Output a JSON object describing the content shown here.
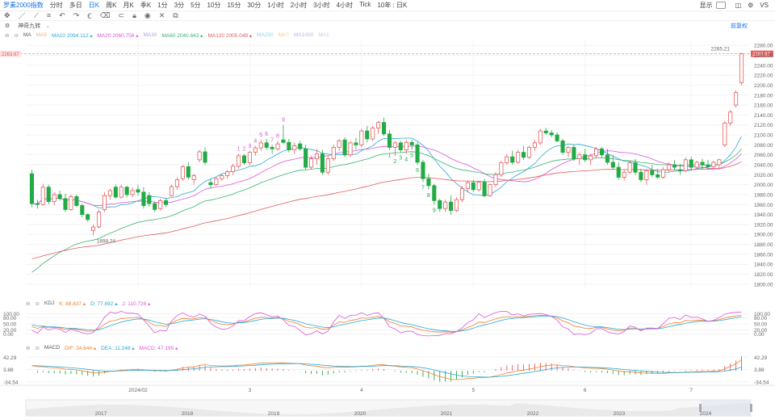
{
  "toolbar": {
    "title": "罗素2000指数",
    "periods": [
      "分时",
      "多日",
      "日K",
      "周K",
      "月K",
      "季K",
      "1分",
      "3分",
      "5分",
      "10分",
      "15分",
      "30分",
      "1小时",
      "2小时",
      "3小时",
      "4小时",
      "Tick"
    ],
    "active_period": "日K",
    "range_select": "10年 : 日K",
    "display_label": "显示",
    "vs_label": "VS"
  },
  "indicator_row": {
    "name": "神奇九转",
    "button": "前复权"
  },
  "ma_legend": [
    {
      "label": "MA",
      "value": "",
      "color": "#555555"
    },
    {
      "label": "MA5",
      "value": "",
      "color": "#f4b183"
    },
    {
      "label": "MA10",
      "value": "2094.112",
      "color": "#29a9d6"
    },
    {
      "label": "MA20",
      "value": "2060.758",
      "color": "#d957d9"
    },
    {
      "label": "MA30",
      "value": "",
      "color": "#a6a6e0"
    },
    {
      "label": "MA60",
      "value": "2040.643",
      "color": "#3cb371"
    },
    {
      "label": "MA120",
      "value": "2005.049",
      "color": "#e45c5c"
    },
    {
      "label": "MA250",
      "value": "",
      "color": "#8fd9e8"
    },
    {
      "label": "MA?",
      "value": "",
      "color": "#f0d080"
    },
    {
      "label": "MA1000",
      "value": "",
      "color": "#c0b0f0"
    },
    {
      "label": "MA1",
      "value": "",
      "color": "#c8c8e8"
    }
  ],
  "kdj_legend": [
    {
      "label": "KDJ",
      "value": "",
      "color": "#555555"
    },
    {
      "label": "K:",
      "value": "88.837",
      "color": "#f08030"
    },
    {
      "label": "D:",
      "value": "77.892",
      "color": "#29a9d6"
    },
    {
      "label": "J:",
      "value": "110.726",
      "color": "#d957d9"
    }
  ],
  "macd_legend": [
    {
      "label": "MACD",
      "value": "",
      "color": "#555555"
    },
    {
      "label": "DIF:",
      "value": "34.644",
      "color": "#f08030"
    },
    {
      "label": "DEA:",
      "value": "11.246",
      "color": "#29a9d6"
    },
    {
      "label": "MACD:",
      "value": "47.195",
      "color": "#d957d9"
    }
  ],
  "chart_data": {
    "type": "candlestick",
    "y_ticks": [
      2280,
      2260,
      2240,
      2220,
      2200,
      2180,
      2160,
      2140,
      2120,
      2100,
      2080,
      2060,
      2040,
      2020,
      2000,
      1980,
      1960,
      1940,
      1920,
      1900,
      1880,
      1860,
      1840,
      1820,
      1800
    ],
    "ylim": [
      1790,
      2290
    ],
    "last_price_label": "2263.67",
    "annotations": {
      "high": "2265.21",
      "low": "1898.24"
    },
    "x_labels": [
      {
        "label": "2024/02",
        "i": 19
      },
      {
        "label": "3",
        "i": 39
      },
      {
        "label": "4",
        "i": 59
      },
      {
        "label": "5",
        "i": 79
      },
      {
        "label": "6",
        "i": 99
      },
      {
        "label": "7",
        "i": 118
      }
    ],
    "nine_turn": [
      {
        "i": 37,
        "n": "1",
        "side": "top"
      },
      {
        "i": 38,
        "n": "2",
        "side": "top"
      },
      {
        "i": 39,
        "n": "3",
        "side": "top"
      },
      {
        "i": 40,
        "n": "4",
        "side": "top"
      },
      {
        "i": 41,
        "n": "5",
        "side": "top"
      },
      {
        "i": 42,
        "n": "6",
        "side": "top"
      },
      {
        "i": 43,
        "n": "7",
        "side": "top"
      },
      {
        "i": 44,
        "n": "8",
        "side": "top"
      },
      {
        "i": 45,
        "n": "9",
        "side": "top"
      },
      {
        "i": 64,
        "n": "1",
        "side": "bottom"
      },
      {
        "i": 65,
        "n": "2",
        "side": "bottom"
      },
      {
        "i": 66,
        "n": "3",
        "side": "bottom"
      },
      {
        "i": 67,
        "n": "4",
        "side": "bottom"
      },
      {
        "i": 68,
        "n": "5",
        "side": "bottom"
      },
      {
        "i": 69,
        "n": "6",
        "side": "bottom"
      },
      {
        "i": 70,
        "n": "7",
        "side": "bottom"
      },
      {
        "i": 71,
        "n": "8",
        "side": "bottom"
      },
      {
        "i": 72,
        "n": "9",
        "side": "bottom"
      }
    ],
    "candles": [
      [
        2022,
        2030,
        1955,
        1962
      ],
      [
        1962,
        1970,
        1952,
        1960
      ],
      [
        1960,
        2002,
        1958,
        1995
      ],
      [
        1995,
        2000,
        1960,
        1966
      ],
      [
        1966,
        1985,
        1958,
        1980
      ],
      [
        1980,
        1988,
        1968,
        1972
      ],
      [
        1972,
        1982,
        1945,
        1950
      ],
      [
        1950,
        1980,
        1948,
        1976
      ],
      [
        1976,
        1980,
        1955,
        1958
      ],
      [
        1958,
        1962,
        1935,
        1940
      ],
      [
        1940,
        1942,
        1926,
        1930
      ],
      [
        1908,
        1920,
        1898,
        1915
      ],
      [
        1915,
        1950,
        1912,
        1945
      ],
      [
        1950,
        1985,
        1945,
        1978
      ],
      [
        1978,
        1992,
        1970,
        1988
      ],
      [
        1995,
        2000,
        1972,
        1975
      ],
      [
        1975,
        2000,
        1972,
        1995
      ],
      [
        1995,
        1998,
        1975,
        1980
      ],
      [
        1980,
        1995,
        1975,
        1988
      ],
      [
        1990,
        2000,
        1978,
        1985
      ],
      [
        1985,
        1995,
        1952,
        1958
      ],
      [
        1978,
        1985,
        1955,
        1962
      ],
      [
        1962,
        1966,
        1945,
        1950
      ],
      [
        1952,
        1972,
        1948,
        1968
      ],
      [
        1968,
        1972,
        1955,
        1960
      ],
      [
        1978,
        2000,
        1976,
        1996
      ],
      [
        1996,
        2015,
        1990,
        2010
      ],
      [
        2012,
        2040,
        2008,
        2036
      ],
      [
        2036,
        2045,
        2010,
        2015
      ],
      [
        2010,
        2022,
        2000,
        2018
      ],
      [
        2050,
        2070,
        2045,
        2066
      ],
      [
        2066,
        2075,
        2040,
        2045
      ],
      [
        2004,
        2012,
        1992,
        2000
      ],
      [
        2000,
        2015,
        1998,
        2012
      ],
      [
        2012,
        2022,
        2008,
        2018
      ],
      [
        2018,
        2030,
        2012,
        2026
      ],
      [
        2026,
        2042,
        2020,
        2037
      ],
      [
        2037,
        2062,
        2032,
        2058
      ],
      [
        2058,
        2062,
        2040,
        2044
      ],
      [
        2044,
        2068,
        2040,
        2065
      ],
      [
        2065,
        2078,
        2058,
        2074
      ],
      [
        2074,
        2090,
        2068,
        2084
      ],
      [
        2084,
        2092,
        2070,
        2075
      ],
      [
        2075,
        2080,
        2062,
        2072
      ],
      [
        2072,
        2088,
        2068,
        2082
      ],
      [
        2090,
        2120,
        2082,
        2085
      ],
      [
        2085,
        2092,
        2065,
        2070
      ],
      [
        2070,
        2085,
        2062,
        2078
      ],
      [
        2082,
        2088,
        2068,
        2072
      ],
      [
        2072,
        2080,
        2030,
        2035
      ],
      [
        2035,
        2058,
        2030,
        2052
      ],
      [
        2052,
        2072,
        2040,
        2062
      ],
      [
        2062,
        2070,
        2020,
        2025
      ],
      [
        2025,
        2058,
        2020,
        2052
      ],
      [
        2052,
        2080,
        2048,
        2075
      ],
      [
        2075,
        2092,
        2068,
        2088
      ],
      [
        2090,
        2095,
        2055,
        2060
      ],
      [
        2060,
        2088,
        2055,
        2084
      ],
      [
        2084,
        2094,
        2070,
        2080
      ],
      [
        2080,
        2112,
        2075,
        2108
      ],
      [
        2108,
        2118,
        2085,
        2092
      ],
      [
        2092,
        2118,
        2088,
        2114
      ],
      [
        2114,
        2128,
        2102,
        2125
      ],
      [
        2125,
        2135,
        2098,
        2102
      ],
      [
        2102,
        2110,
        2070,
        2075
      ],
      [
        2075,
        2088,
        2058,
        2084
      ],
      [
        2084,
        2088,
        2065,
        2070
      ],
      [
        2070,
        2090,
        2062,
        2085
      ],
      [
        2085,
        2090,
        2070,
        2080
      ],
      [
        2080,
        2085,
        2040,
        2045
      ],
      [
        2045,
        2050,
        2005,
        2012
      ],
      [
        2012,
        2022,
        1990,
        1998
      ],
      [
        1998,
        2002,
        1960,
        1968
      ],
      [
        1968,
        1972,
        1945,
        1952
      ],
      [
        1952,
        1970,
        1945,
        1965
      ],
      [
        1965,
        1978,
        1940,
        1948
      ],
      [
        1948,
        1975,
        1945,
        1970
      ],
      [
        1970,
        1998,
        1965,
        1992
      ],
      [
        1992,
        2008,
        1985,
        2004
      ],
      [
        2004,
        2010,
        1985,
        1990
      ],
      [
        1990,
        2008,
        1986,
        2005
      ],
      [
        2005,
        2012,
        1975,
        1978
      ],
      [
        1978,
        2002,
        1975,
        2000
      ],
      [
        2000,
        2025,
        1995,
        2020
      ],
      [
        2020,
        2048,
        2015,
        2044
      ],
      [
        2044,
        2062,
        2040,
        2056
      ],
      [
        2056,
        2068,
        2040,
        2045
      ],
      [
        2045,
        2070,
        2042,
        2065
      ],
      [
        2065,
        2078,
        2050,
        2055
      ],
      [
        2055,
        2078,
        2052,
        2075
      ],
      [
        2075,
        2090,
        2068,
        2084
      ],
      [
        2084,
        2112,
        2080,
        2108
      ],
      [
        2108,
        2114,
        2100,
        2104
      ],
      [
        2104,
        2110,
        2095,
        2100
      ],
      [
        2100,
        2105,
        2085,
        2088
      ],
      [
        2088,
        2092,
        2060,
        2065
      ],
      [
        2065,
        2078,
        2055,
        2075
      ],
      [
        2075,
        2080,
        2048,
        2052
      ],
      [
        2052,
        2064,
        2040,
        2060
      ],
      [
        2060,
        2072,
        2045,
        2050
      ],
      [
        2050,
        2062,
        2040,
        2058
      ],
      [
        2058,
        2076,
        2054,
        2072
      ],
      [
        2072,
        2076,
        2055,
        2060
      ],
      [
        2060,
        2072,
        2040,
        2045
      ],
      [
        2045,
        2060,
        2030,
        2035
      ],
      [
        2035,
        2045,
        2010,
        2015
      ],
      [
        2015,
        2030,
        2008,
        2025
      ],
      [
        2025,
        2048,
        2022,
        2044
      ],
      [
        2044,
        2052,
        2020,
        2025
      ],
      [
        2025,
        2032,
        2005,
        2010
      ],
      [
        2010,
        2030,
        2000,
        2028
      ],
      [
        2028,
        2040,
        2015,
        2020
      ],
      [
        2020,
        2032,
        2012,
        2015
      ],
      [
        2015,
        2035,
        2012,
        2030
      ],
      [
        2030,
        2045,
        2025,
        2040
      ],
      [
        2040,
        2050,
        2030,
        2035
      ],
      [
        2030,
        2042,
        2020,
        2028
      ],
      [
        2028,
        2055,
        2025,
        2050
      ],
      [
        2050,
        2056,
        2030,
        2035
      ],
      [
        2035,
        2048,
        2032,
        2045
      ],
      [
        2045,
        2052,
        2030,
        2040
      ],
      [
        2040,
        2050,
        2030,
        2036
      ],
      [
        2036,
        2048,
        2032,
        2045
      ],
      [
        2040,
        2052,
        2032,
        2050
      ],
      [
        2080,
        2128,
        2076,
        2124
      ],
      [
        2124,
        2150,
        2118,
        2146
      ],
      [
        2160,
        2190,
        2155,
        2185
      ],
      [
        2205,
        2265,
        2200,
        2263
      ]
    ],
    "kdj": {
      "ylim": [
        -10,
        110
      ],
      "y_ticks": [
        100,
        80,
        50,
        20,
        0
      ],
      "y_tick_labels": [
        "100.00",
        "80.00",
        "50.00",
        "20.00",
        "0.00"
      ]
    },
    "macd": {
      "ylim": [
        -40,
        48
      ],
      "y_ticks": [
        42.29,
        3.88,
        -34.54
      ],
      "y_tick_labels": [
        "42.29",
        "3.88",
        "-34.54"
      ]
    },
    "timeline_years": [
      "2017",
      "2018",
      "2019",
      "2020",
      "2021",
      "2022",
      "2023",
      "2024"
    ]
  }
}
